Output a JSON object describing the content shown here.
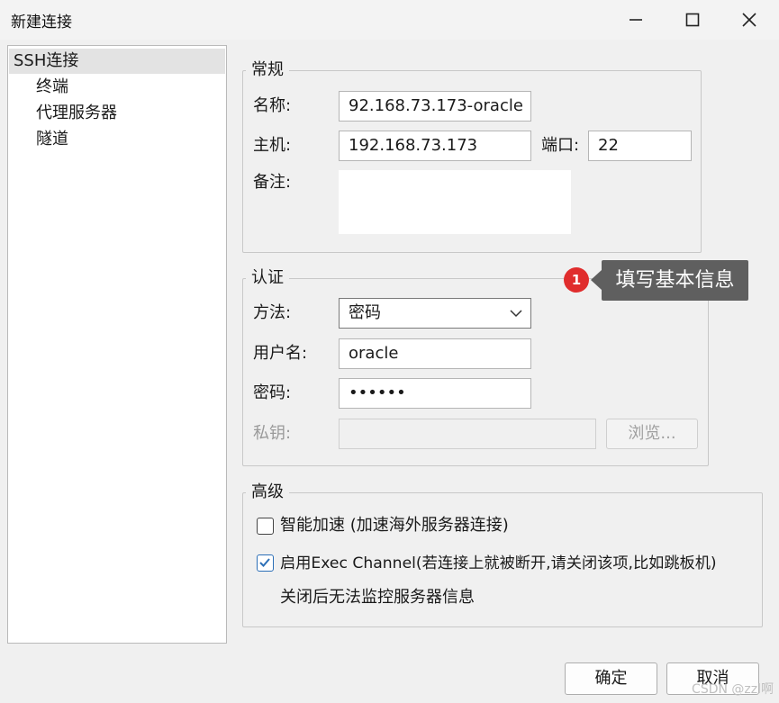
{
  "window": {
    "title": "新建连接"
  },
  "tree": {
    "items": [
      "SSH连接",
      "终端",
      "代理服务器",
      "隧道"
    ]
  },
  "general": {
    "legend": "常规",
    "name_label": "名称:",
    "name_value": "92.168.73.173-oracle",
    "host_label": "主机:",
    "host_value": "192.168.73.173",
    "port_label": "端口:",
    "port_value": "22",
    "note_label": "备注:",
    "note_value": ""
  },
  "auth": {
    "legend": "认证",
    "method_label": "方法:",
    "method_value": "密码",
    "user_label": "用户名:",
    "user_value": "oracle",
    "password_label": "密码:",
    "password_value": "••••••",
    "key_label": "私钥:",
    "key_value": "",
    "browse_label": "浏览..."
  },
  "advanced": {
    "legend": "高级",
    "smart_accel_label": "智能加速 (加速海外服务器连接)",
    "smart_accel_checked": false,
    "exec_channel_label": "启用Exec Channel(若连接上就被断开,请关闭该项,比如跳板机)",
    "exec_channel_checked": true,
    "exec_channel_note": "关闭后无法监控服务器信息"
  },
  "annotation": {
    "badge": "1",
    "text": "填写基本信息"
  },
  "footer": {
    "ok_label": "确定",
    "cancel_label": "取消"
  },
  "watermark": "CSDN @zzl啊",
  "colors": {
    "accent": "#2c6fb7",
    "badge": "#e02d2d",
    "tooltip": "#5f5f5f"
  }
}
